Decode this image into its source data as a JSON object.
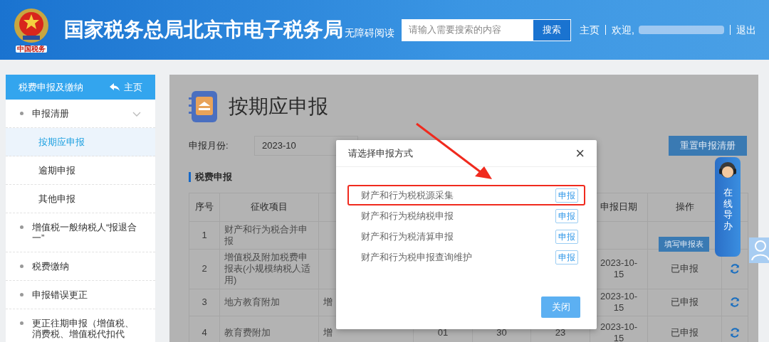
{
  "header": {
    "logo_caption": "中国税务",
    "title": "国家税务总局北京市电子税务局",
    "accessibility_link": "无障碍阅读",
    "search": {
      "placeholder": "请输入需要搜索的内容",
      "button": "搜索"
    },
    "nav": [
      {
        "kind": "link",
        "label": "主页"
      },
      {
        "kind": "welcome",
        "label": "欢迎,"
      },
      {
        "kind": "link",
        "label": "退出"
      }
    ]
  },
  "sidebar": {
    "title": "税费申报及缴纳",
    "home_link": "主页",
    "items": [
      {
        "label": "申报清册",
        "expanded": true,
        "children": [
          {
            "label": "按期应申报",
            "selected": true
          },
          {
            "label": "逾期申报",
            "selected": false
          },
          {
            "label": "其他申报",
            "selected": false
          }
        ]
      },
      {
        "label": "增值税一般纳税人“报退合一”",
        "expanded": false
      },
      {
        "label": "税费缴纳",
        "expanded": false
      },
      {
        "label": "申报错误更正",
        "expanded": false
      },
      {
        "label": "更正往期申报（增值税、消费税、增值税代扣代",
        "expanded": false
      }
    ]
  },
  "page": {
    "title": "按期应申报",
    "month_label": "申报月份:",
    "month_value": "2023-10",
    "reset_button": "重置申报清册",
    "section_title": "税费申报",
    "table": {
      "columns": [
        "序号",
        "征收项目",
        "",
        "",
        "",
        "",
        "申报日期",
        "操作",
        ""
      ],
      "rows": [
        {
          "cells": [
            "1",
            "财产和行为税合并申报",
            "",
            "",
            "",
            "",
            "",
            ""
          ],
          "action": {
            "kind": "button",
            "label": "填写申报表"
          }
        },
        {
          "cells": [
            "2",
            "增值税及附加税费申报表(小规模纳税人适用)",
            "",
            "",
            "",
            "",
            "2023-10-15",
            "已申报"
          ],
          "action": {
            "kind": "refresh"
          }
        },
        {
          "cells": [
            "3",
            "地方教育附加",
            "增",
            "",
            "",
            "",
            "2023-10-15",
            "已申报"
          ],
          "action": {
            "kind": "refresh"
          }
        },
        {
          "cells": [
            "4",
            "教育费附加",
            "增",
            "01",
            "30",
            "23",
            "2023-10-15",
            "已申报"
          ],
          "action": {
            "kind": "refresh"
          }
        }
      ]
    }
  },
  "modal": {
    "title": "请选择申报方式",
    "close_symbol": "×",
    "options": [
      {
        "label": "财产和行为税税源采集",
        "button": "申报",
        "highlighted": true
      },
      {
        "label": "财产和行为税纳税申报",
        "button": "申报",
        "highlighted": false
      },
      {
        "label": "财产和行为税清算申报",
        "button": "申报",
        "highlighted": false
      },
      {
        "label": "财产和行为税申报查询维护",
        "button": "申报",
        "highlighted": false
      }
    ],
    "close_button": "关闭"
  },
  "guide_widget": {
    "label": "在线导办"
  }
}
